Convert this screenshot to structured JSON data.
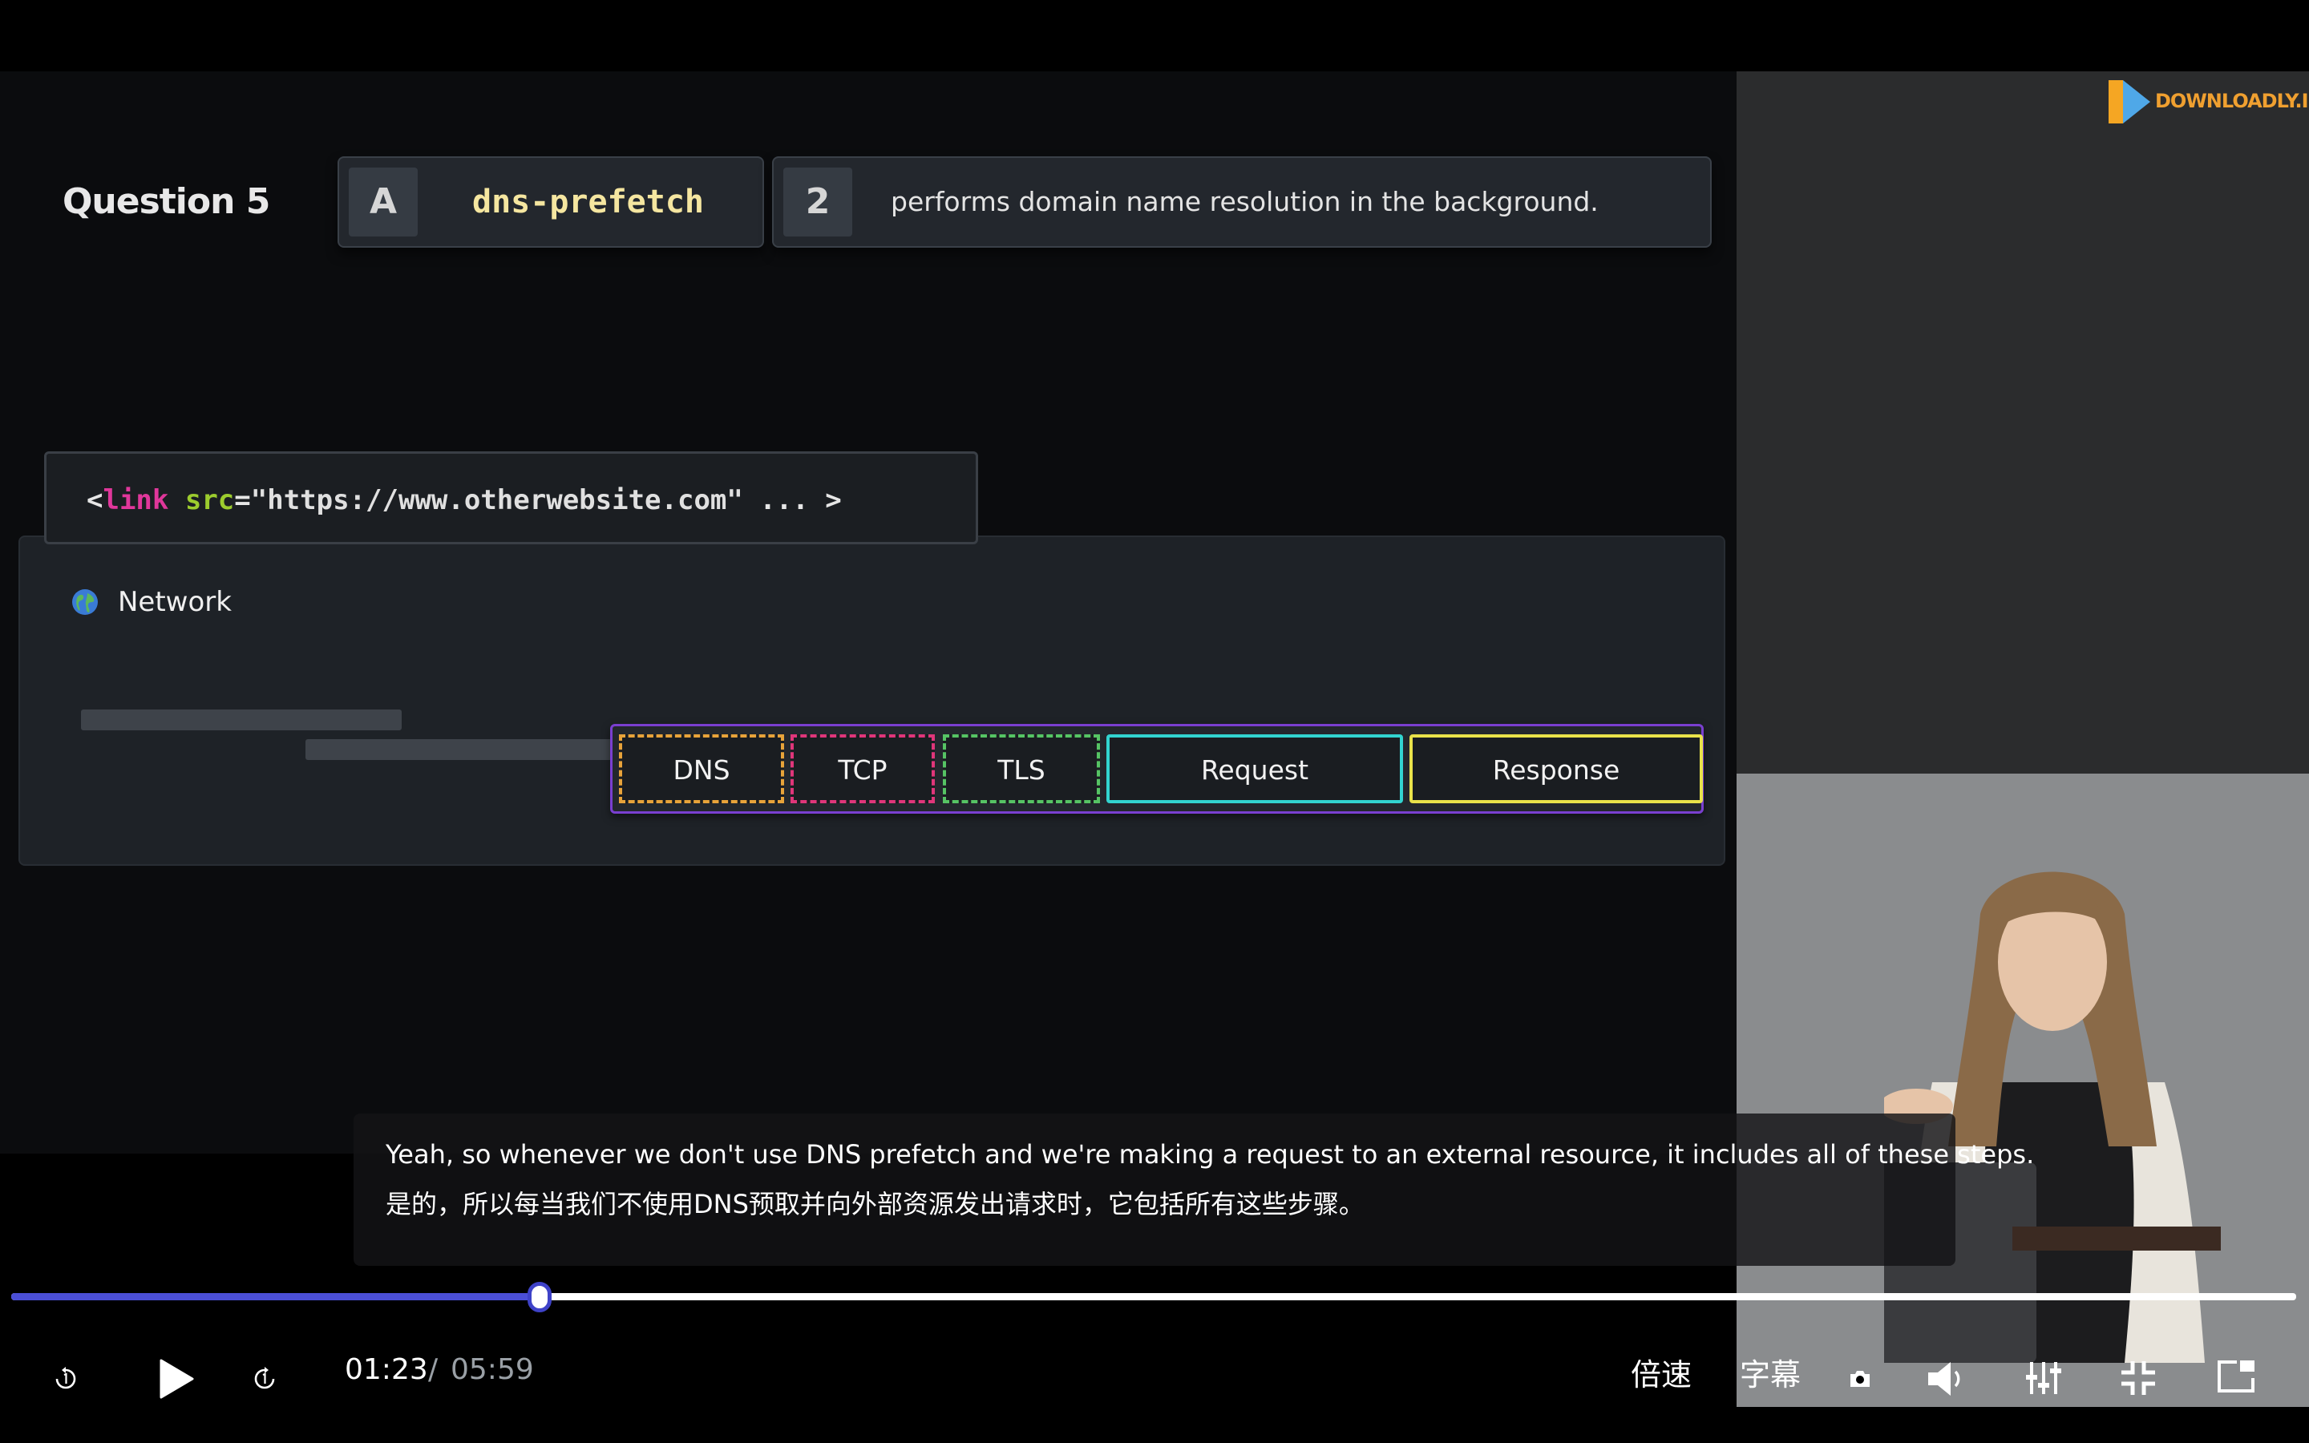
{
  "slide": {
    "question_label": "Question 5",
    "card_a": {
      "badge": "A",
      "text": "dns-prefetch"
    },
    "card_2": {
      "badge": "2",
      "text": "performs domain name resolution in the background."
    },
    "code": {
      "open": "<",
      "tag": "link",
      "attr": "src",
      "eq": "=",
      "value": "\"https://www.otherwebsite.com\"",
      "rest": " ... >"
    },
    "network": {
      "title": "Network",
      "timeline": {
        "dns": "DNS",
        "tcp": "TCP",
        "tls": "TLS",
        "request": "Request",
        "response": "Response"
      }
    }
  },
  "logo": {
    "text": "DOWNLOADLY.IR"
  },
  "subtitles": {
    "en": "Yeah, so whenever we don't use DNS prefetch and we're making a request to an external resource, it includes all of these steps.",
    "zh": "是的，所以每当我们不使用DNS预取并向外部资源发出请求时，它包括所有这些步骤。"
  },
  "player": {
    "current_time": "01:23",
    "separator": "/",
    "total_time": "05:59",
    "progress": 0.2312,
    "speed_label": "倍速",
    "subtitle_label": "字幕"
  },
  "icons": {
    "rewind": "rewind-icon",
    "play": "play-icon",
    "forward": "forward-icon",
    "screenshot": "camera-icon",
    "volume": "volume-icon",
    "settings": "equalizer-icon",
    "exit_fullscreen": "exit-fullscreen-icon",
    "pip": "picture-in-picture-icon"
  },
  "colors": {
    "progress_fill": "#4b4fd6",
    "dns": "#e8a33a",
    "tcp": "#e0367a",
    "tls": "#56c464",
    "request": "#32d4d0",
    "response": "#e9e24a",
    "timeline_border": "#7a3fd0"
  }
}
